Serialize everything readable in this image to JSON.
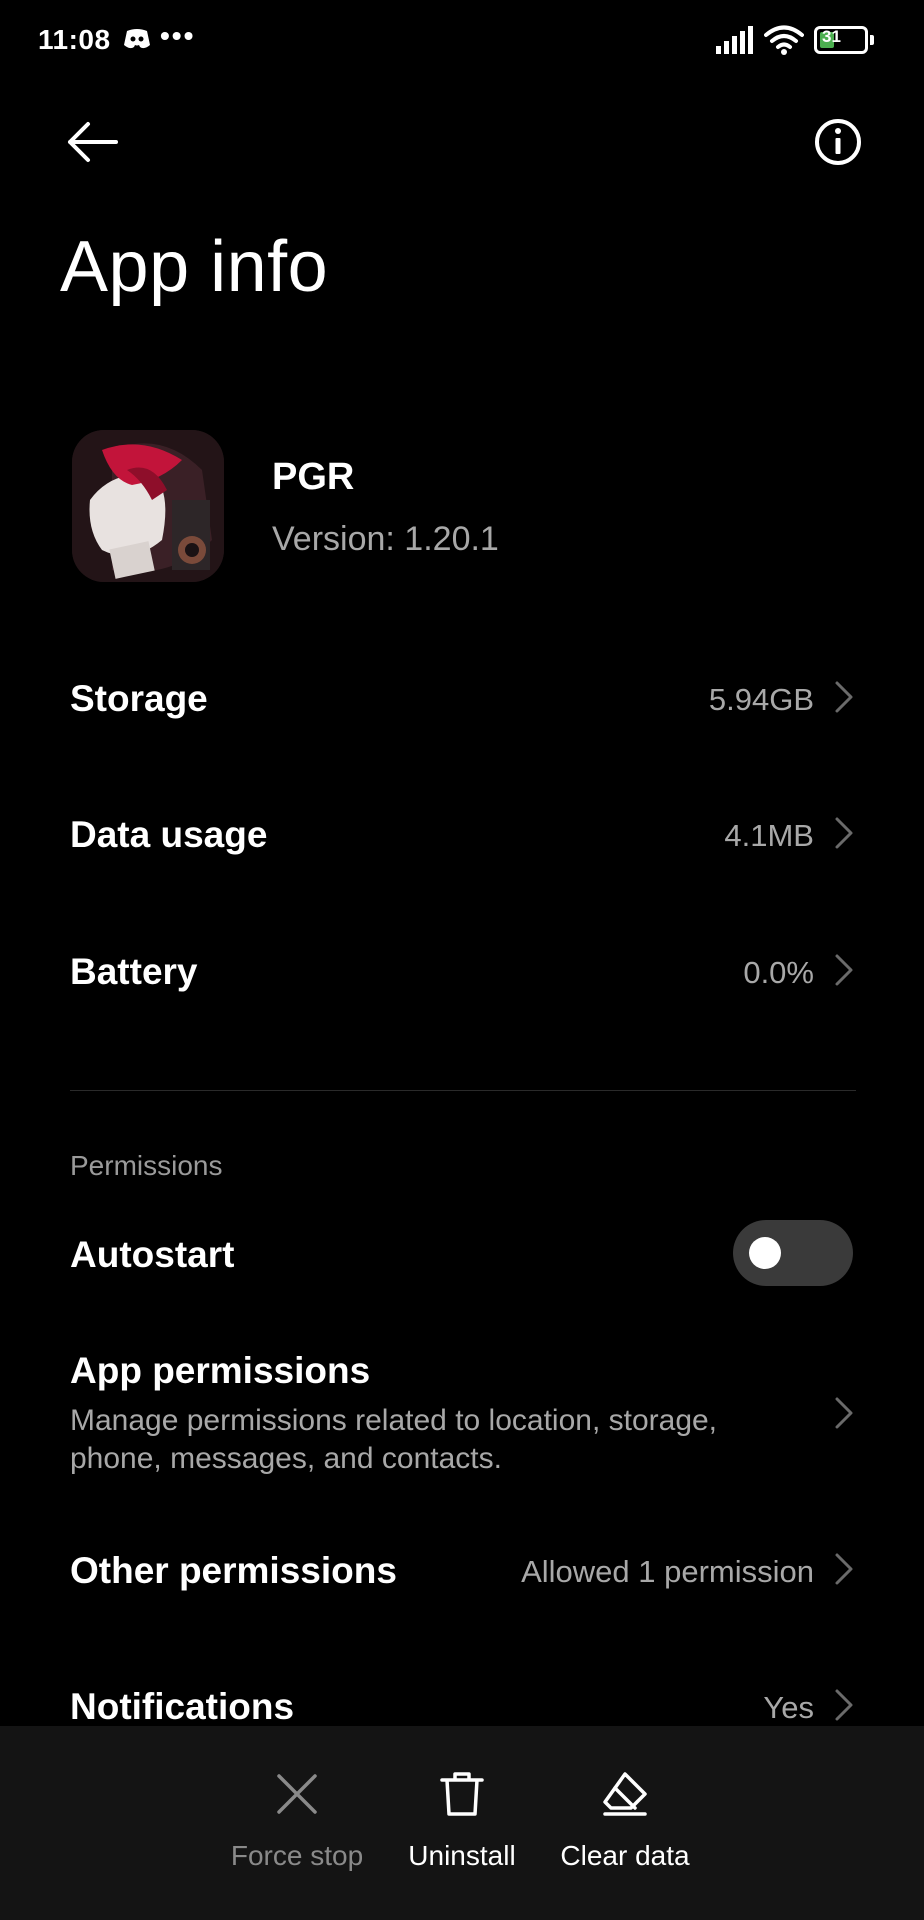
{
  "status_bar": {
    "time": "11:08",
    "dots": "•••",
    "battery_level": "31",
    "battery_color": "#4caf50"
  },
  "header": {
    "title": "App info"
  },
  "app": {
    "name": "PGR",
    "version": "Version: 1.20.1"
  },
  "rows": {
    "storage": {
      "label": "Storage",
      "value": "5.94GB"
    },
    "data_usage": {
      "label": "Data usage",
      "value": "4.1MB"
    },
    "battery": {
      "label": "Battery",
      "value": "0.0%"
    }
  },
  "permissions": {
    "section_title": "Permissions",
    "autostart": {
      "label": "Autostart",
      "enabled": false
    },
    "app_permissions": {
      "label": "App permissions",
      "description": "Manage permissions related to location, storage, phone, messages, and contacts."
    },
    "other_permissions": {
      "label": "Other permissions",
      "value": "Allowed 1 permission"
    },
    "notifications": {
      "label": "Notifications",
      "value": "Yes"
    }
  },
  "actions": {
    "force_stop": {
      "label": "Force stop",
      "icon": "close-icon",
      "enabled": false
    },
    "uninstall": {
      "label": "Uninstall",
      "icon": "trash-icon",
      "enabled": true
    },
    "clear_data": {
      "label": "Clear data",
      "icon": "eraser-icon",
      "enabled": true
    }
  },
  "colors": {
    "background": "#000000",
    "bottom_bar": "#141414",
    "secondary_text": "#a8a8a8",
    "disabled_text": "#8a8a8a"
  }
}
